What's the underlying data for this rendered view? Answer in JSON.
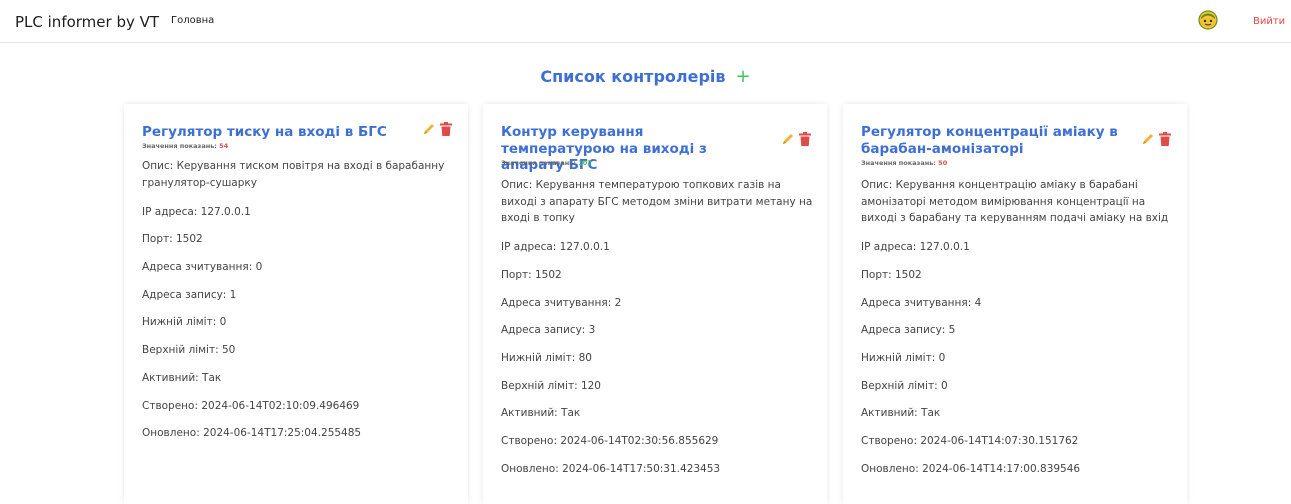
{
  "navbar": {
    "brand": "PLC informer by VT",
    "home": "Головна",
    "logout": "Вийти",
    "avatar_icon": "user-avatar-icon"
  },
  "page": {
    "title": "Список контролерів",
    "add_icon": "plus-icon"
  },
  "colors": {
    "accent": "#3e6fd4",
    "danger": "#e04a4a",
    "success": "#3cb84f",
    "edit": "#f2b233"
  },
  "controllers": [
    {
      "title": "Регулятор тиску на вході в БГС",
      "reading_label": "Значення показань:",
      "reading_value": "54",
      "description": "Опис: Керування тиском повітря на вході в барабанну гранулятор-сушарку",
      "ip": "IP адреса: 127.0.0.1",
      "port": "Порт: 1502",
      "read_address": "Адреса зчитування: 0",
      "write_address": "Адреса запису: 1",
      "low_limit": "Нижній ліміт: 0",
      "high_limit": "Верхній ліміт: 50",
      "active": "Активний: Так",
      "created": "Створено: 2024-06-14T02:10:09.496469",
      "updated": "Оновлено: 2024-06-14T17:25:04.255485"
    },
    {
      "title": "Контур керування температурою на виході з апарату БГС",
      "reading_label": "Значення показань:",
      "reading_value": "107",
      "description": "Опис: Керування температурою топкових газів на виході з апарату БГС методом зміни витрати метану на вході в топку",
      "ip": "IP адреса: 127.0.0.1",
      "port": "Порт: 1502",
      "read_address": "Адреса зчитування: 2",
      "write_address": "Адреса запису: 3",
      "low_limit": "Нижній ліміт: 80",
      "high_limit": "Верхній ліміт: 120",
      "active": "Активний: Так",
      "created": "Створено: 2024-06-14T02:30:56.855629",
      "updated": "Оновлено: 2024-06-14T17:50:31.423453"
    },
    {
      "title": "Регулятор концентрації аміаку в барабан-амонізаторі",
      "reading_label": "Значення показань:",
      "reading_value": "50",
      "description": "Опис: Керування концентрацію аміаку в барабані амонізаторі методом вимірювання концентрації на виході з барабану та керуванням подачі аміаку на вхід",
      "ip": "IP адреса: 127.0.0.1",
      "port": "Порт: 1502",
      "read_address": "Адреса зчитування: 4",
      "write_address": "Адреса запису: 5",
      "low_limit": "Нижній ліміт: 0",
      "high_limit": "Верхній ліміт: 0",
      "active": "Активний: Так",
      "created": "Створено: 2024-06-14T14:07:30.151762",
      "updated": "Оновлено: 2024-06-14T14:17:00.839546"
    }
  ]
}
